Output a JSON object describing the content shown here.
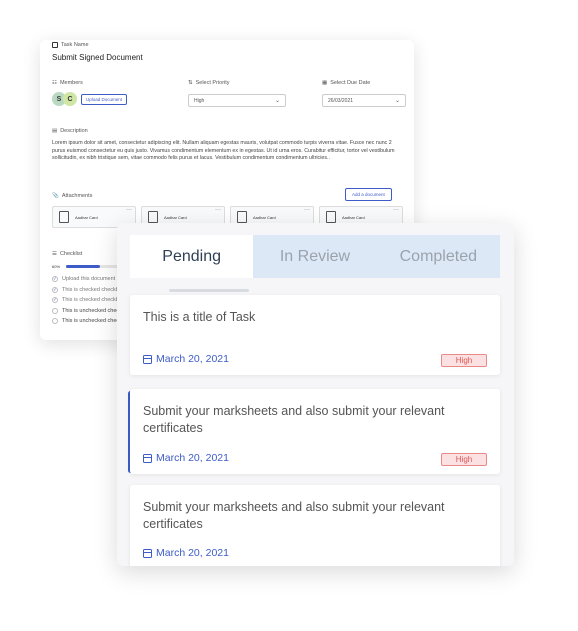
{
  "detail": {
    "task_name_label": "Task Name",
    "task_title": "Submit Signed Document",
    "members_label": "Members",
    "avatars": [
      "S",
      "C"
    ],
    "upload_button": "Upload Document",
    "priority_label": "Select Priority",
    "priority_value": "High",
    "due_label": "Select Due Date",
    "due_value": "26/03/2021",
    "description_label": "Description",
    "description_text": "Lorem ipsum dolor sit amet, consectetur adipiscing elit. Nullam aliquam egestas mauris, volutpat commodo turpis viverra vitae. Fusce nec nunc 2 purus euismod consectetur eu quis justo. Vivamus condimentum elementum ex in egestas. Ut id urna eros. Curabitur efficitur, tortor vel vestibulum sollicitudin, ex nibh tristique sem, vitae commodo felis purus et lacus. Vestibulum condimentum condimentum ultricies..",
    "attachments_label": "Attachments",
    "add_document_button": "Add a document",
    "attachments": [
      "Aadhar Card",
      "Aadhar Card",
      "Aadhar Card",
      "Aadhar Card"
    ],
    "checklist_label": "Checklist",
    "progress_text": "60%",
    "progress_fraction": 0.6,
    "checklist": [
      {
        "label": "Upload this document",
        "checked": true
      },
      {
        "label": "This is checked checkbox",
        "checked": true
      },
      {
        "label": "This is checked checkbox",
        "checked": true
      },
      {
        "label": "This is unchecked checkbox",
        "checked": false
      },
      {
        "label": "This is unchecked checkbox",
        "checked": false
      }
    ]
  },
  "list": {
    "tabs": [
      "Pending",
      "In Review",
      "Completed"
    ],
    "active_tab": 0,
    "tasks": [
      {
        "title": "This is a title of Task",
        "date": "March 20, 2021",
        "badge": "High"
      },
      {
        "title": "Submit your marksheets and also submit your relevant certificates",
        "date": "March 20, 2021",
        "badge": "High"
      },
      {
        "title": "Submit your marksheets and also submit your relevant certificates",
        "date": "March 20, 2021",
        "badge": ""
      }
    ]
  },
  "colors": {
    "accent": "#3d5cc7",
    "badge_bg": "#fbe1e1",
    "badge_text": "#e05757",
    "tab_bar": "#dde8f6"
  }
}
